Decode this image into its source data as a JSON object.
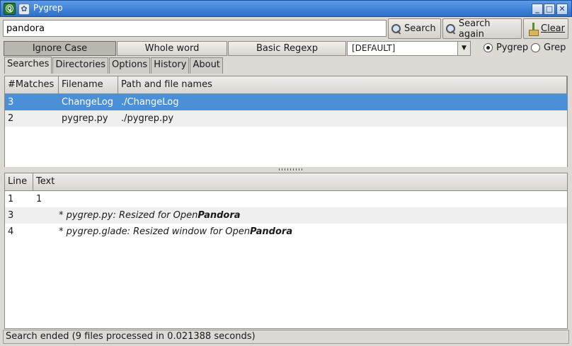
{
  "window": {
    "title": "Pygrep",
    "app_icon_glyph": "Ⓠ"
  },
  "search": {
    "value": "pandora",
    "search_label": "Search",
    "search_again_label": "Search again",
    "clear_label": "Clear"
  },
  "options": {
    "ignore_case": "Ignore Case",
    "whole_word": "Whole word",
    "basic_regexp": "Basic Regexp",
    "combo_value": "[DEFAULT]",
    "radio_pygrep": "Pygrep",
    "radio_grep": "Grep",
    "selected_engine": "Pygrep"
  },
  "tabs": [
    "Searches",
    "Directories",
    "Options",
    "History",
    "About"
  ],
  "files_table": {
    "headers": [
      "#Matches",
      "Filename",
      "Path and file names"
    ],
    "rows": [
      {
        "matches": "3",
        "filename": "ChangeLog",
        "path": "./ChangeLog"
      },
      {
        "matches": "2",
        "filename": "pygrep.py",
        "path": "./pygrep.py"
      }
    ]
  },
  "lines_table": {
    "headers": [
      "Line",
      "Text"
    ],
    "rows": [
      {
        "line": "1",
        "text_pre": "1",
        "text_bold": ""
      },
      {
        "line": "3",
        "text_pre": "* pygrep.py: Resized for Open",
        "text_bold": "Pandora"
      },
      {
        "line": "4",
        "text_pre": "* pygrep.glade: Resized window for Open",
        "text_bold": "Pandora"
      }
    ]
  },
  "status": "Search ended (9 files processed in 0.021388 seconds)",
  "colors": {
    "selection": "#4a90d9",
    "titlebar": "#3a7fd5"
  }
}
